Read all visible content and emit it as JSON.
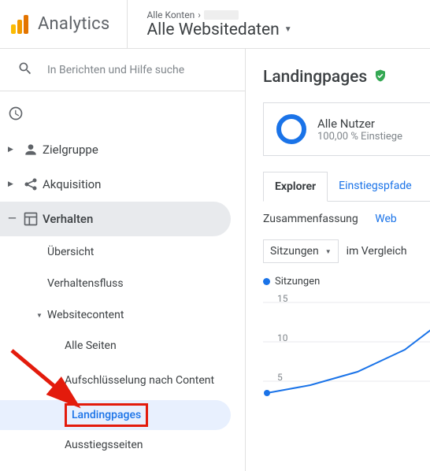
{
  "header": {
    "product": "Analytics",
    "breadcrumb_label": "Alle Konten",
    "view_name": "Alle Websitedaten"
  },
  "search": {
    "placeholder": "In Berichten und Hilfe suche"
  },
  "nav": {
    "audience": "Zielgruppe",
    "acquisition": "Akquisition",
    "behavior": "Verhalten",
    "sub_overview": "Übersicht",
    "sub_flow": "Verhaltensfluss",
    "sub_sitecontent": "Websitecontent",
    "sc_allpages": "Alle Seiten",
    "sc_drilldown": "Aufschlüsselung nach Content",
    "sc_landing": "Landingpages",
    "sc_exit": "Ausstiegsseiten"
  },
  "content": {
    "title": "Landingpages",
    "segment_title": "Alle Nutzer",
    "segment_sub": "100,00 % Einstiege",
    "tab_explorer": "Explorer",
    "tab_paths": "Einstiegspfade",
    "summary": "Zusammenfassung",
    "weblink": "Web",
    "metric_dropdown": "Sitzungen",
    "compare": "im Vergleich",
    "legend": "Sitzungen"
  },
  "chart_data": {
    "type": "line",
    "series": [
      {
        "name": "Sitzungen",
        "values": [
          2,
          3,
          5,
          8,
          12
        ]
      }
    ],
    "x": [
      0,
      1,
      2,
      3,
      4
    ],
    "ylim": [
      0,
      15
    ],
    "yticks": [
      5,
      10,
      15
    ],
    "xlabel": "",
    "ylabel": ""
  }
}
